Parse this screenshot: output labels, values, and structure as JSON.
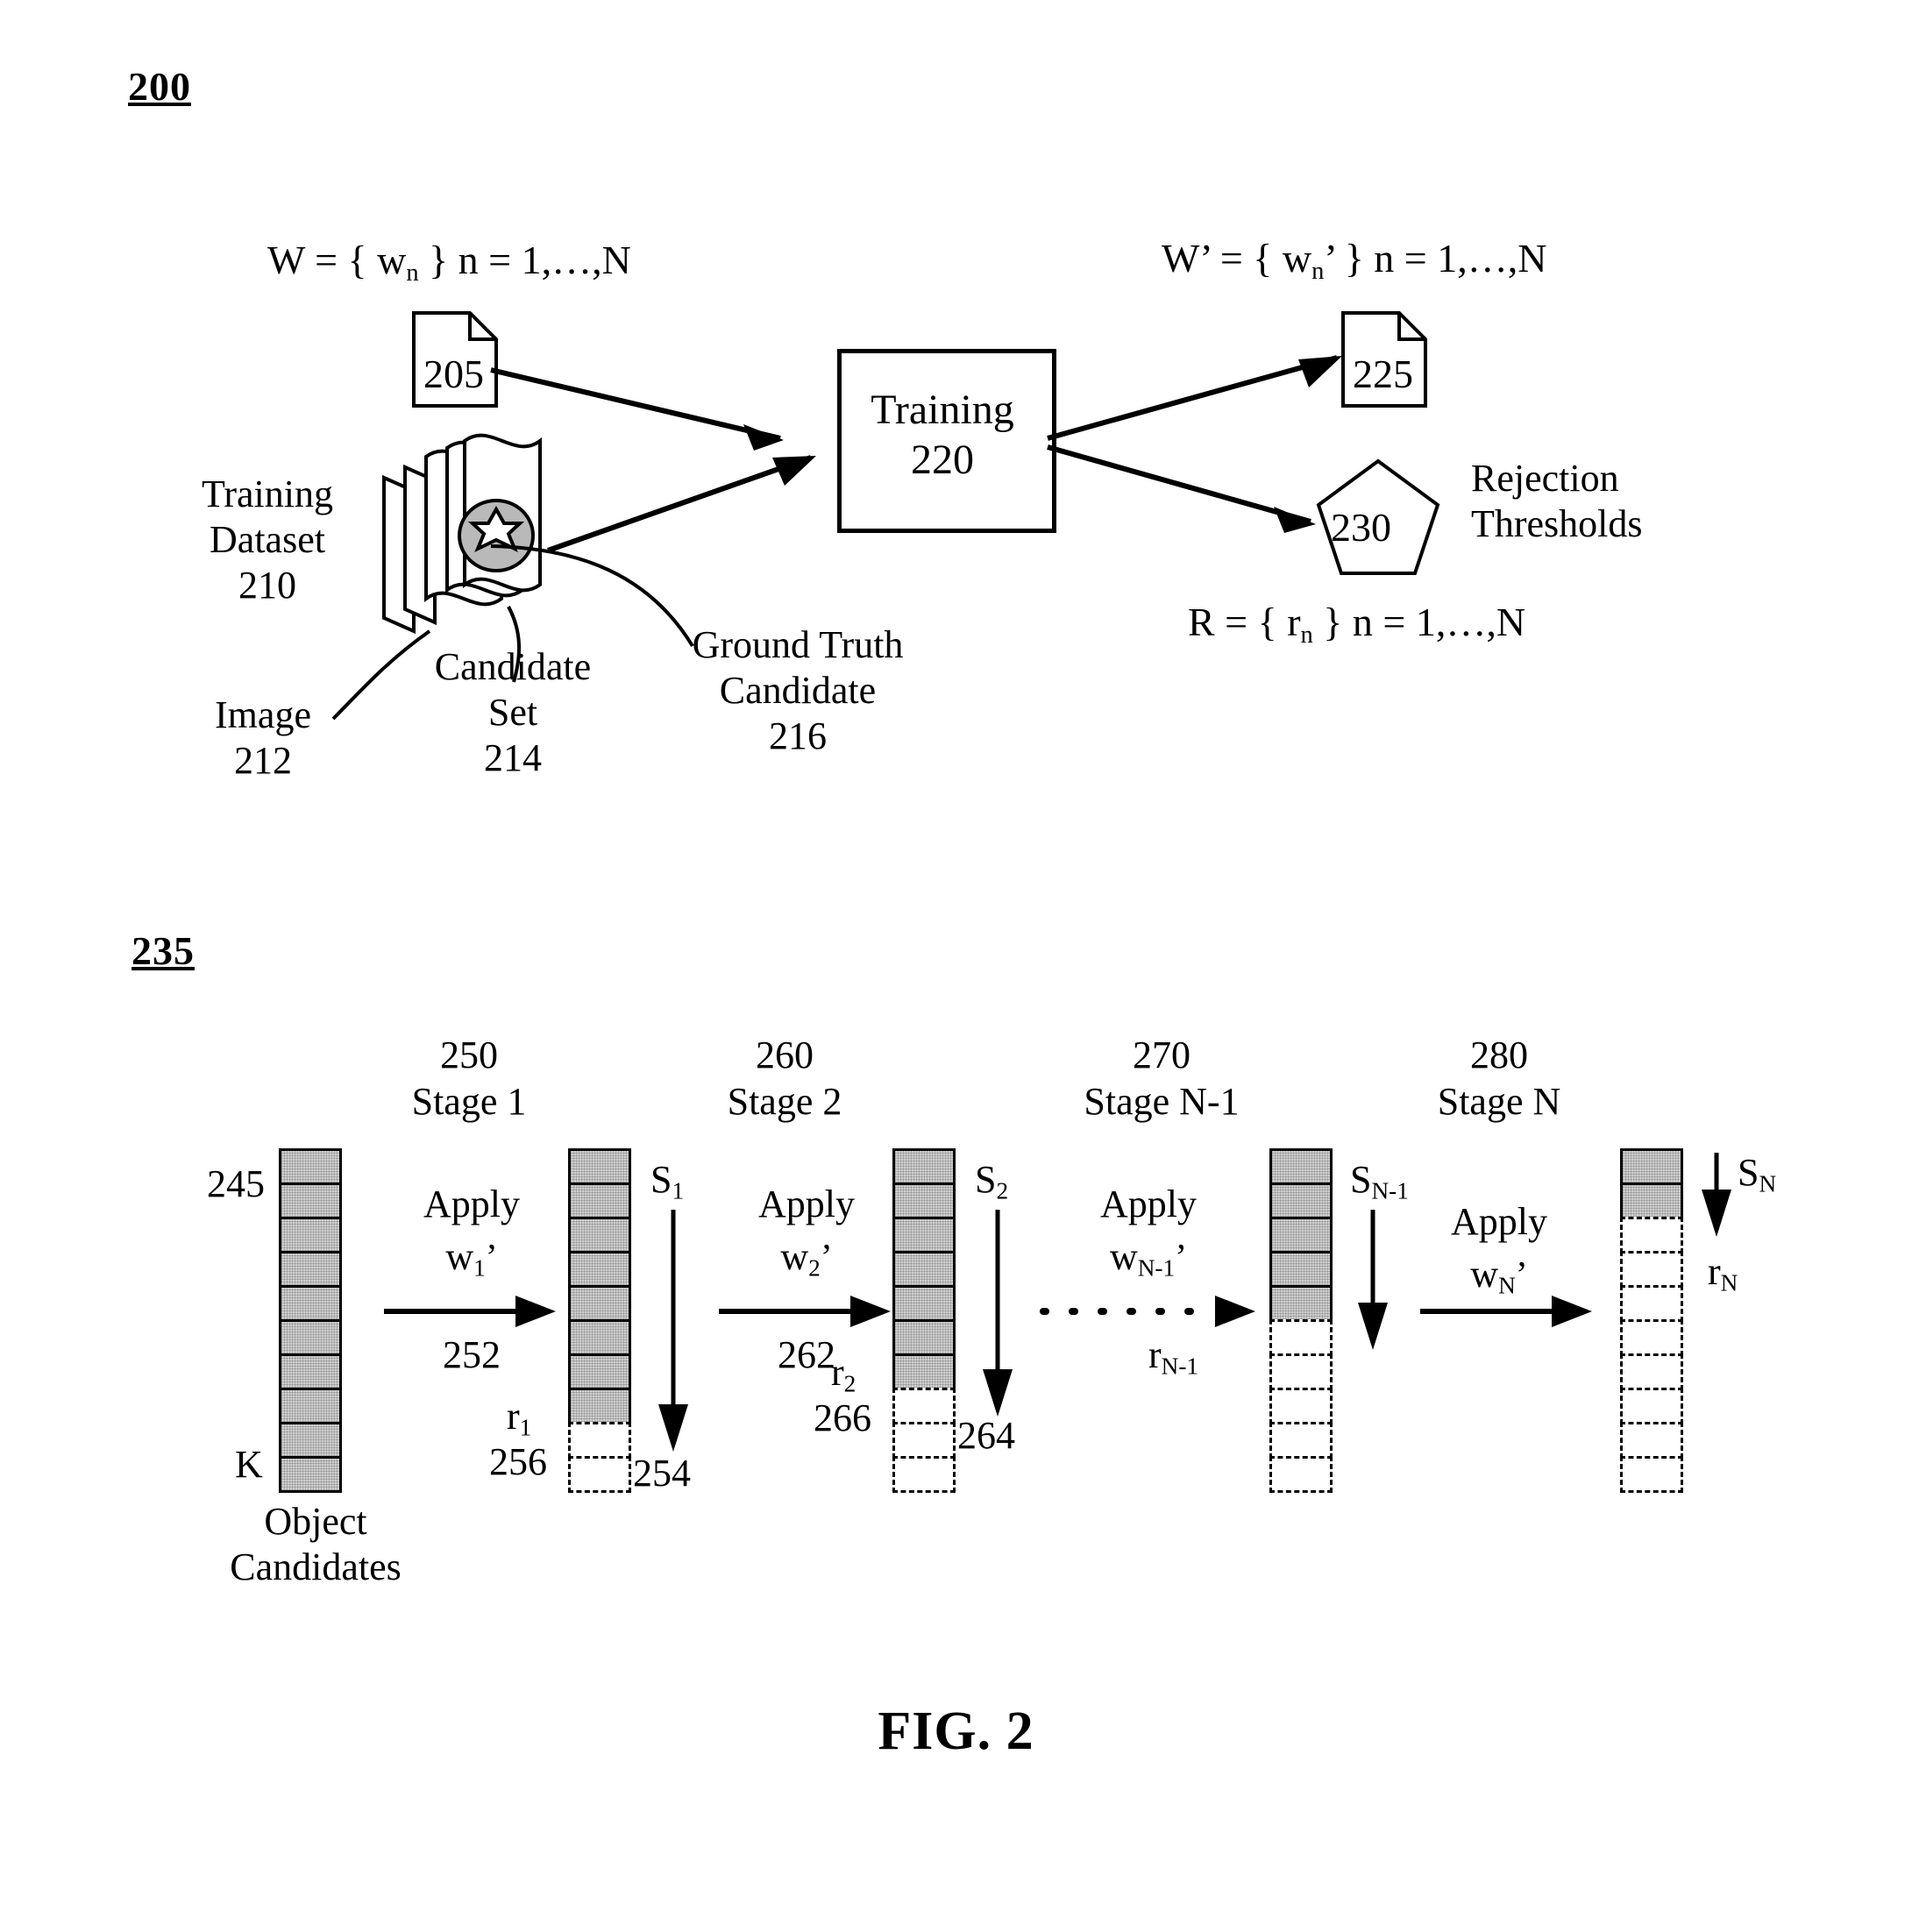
{
  "figure": {
    "caption": "FIG. 2",
    "top_diagram_id": "200",
    "bottom_diagram_id": "235"
  },
  "training_flow": {
    "weights_in_equation": "W = { w",
    "weights_in_equation_sub": "n",
    "weights_in_equation_tail": " } n = 1,…,N",
    "weights_in_doc_label": "205",
    "dataset_label_line1": "Training",
    "dataset_label_line2": "Dataset",
    "dataset_label_id": "210",
    "image_label": "Image",
    "image_label_id": "212",
    "candidate_set_label_line1": "Candidate",
    "candidate_set_label_line2": "Set",
    "candidate_set_label_id": "214",
    "ground_truth_label_line1": "Ground Truth",
    "ground_truth_label_line2": "Candidate",
    "ground_truth_label_id": "216",
    "training_box_label": "Training",
    "training_box_id": "220",
    "weights_out_equation": "W’ = { w",
    "weights_out_equation_sub": "n",
    "weights_out_equation_tail": "’ } n = 1,…,N",
    "weights_out_doc_label": "225",
    "thresholds_pentagon_label": "230",
    "thresholds_caption_line1": "Rejection",
    "thresholds_caption_line2": "Thresholds",
    "thresholds_equation": "R = { r",
    "thresholds_equation_sub": "n",
    "thresholds_equation_tail": " } n = 1,…,N"
  },
  "cascade": {
    "input_column": {
      "id_label": "245",
      "count_label": "K",
      "caption_line1": "Object",
      "caption_line2": "Candidates",
      "filled_cells": 10,
      "empty_cells": 0
    },
    "stages": [
      {
        "id": "250",
        "name": "Stage 1",
        "apply_label": "Apply",
        "apply_weight": "w",
        "apply_weight_sub": "1",
        "apply_weight_prime": "’",
        "arrow_id": "252",
        "score_label": "S",
        "score_sub": "1",
        "score_arrow_id": "254",
        "threshold_label": "r",
        "threshold_sub": "1",
        "threshold_id": "256",
        "filled_cells": 8,
        "empty_cells": 2
      },
      {
        "id": "260",
        "name": "Stage 2",
        "apply_label": "Apply",
        "apply_weight": "w",
        "apply_weight_sub": "2",
        "apply_weight_prime": "’",
        "arrow_id": "262",
        "score_label": "S",
        "score_sub": "2",
        "score_arrow_id": "264",
        "threshold_label": "r",
        "threshold_sub": "2",
        "threshold_id": "266",
        "filled_cells": 7,
        "empty_cells": 3
      },
      {
        "id": "270",
        "name": "Stage N-1",
        "apply_label": "Apply",
        "apply_weight": "w",
        "apply_weight_sub": "N-1",
        "apply_weight_prime": "’",
        "arrow_id": "",
        "score_label": "S",
        "score_sub": "N-1",
        "score_arrow_id": "",
        "threshold_label": "r",
        "threshold_sub": "N-1",
        "threshold_id": "",
        "filled_cells": 5,
        "empty_cells": 5
      },
      {
        "id": "280",
        "name": "Stage N",
        "apply_label": "Apply",
        "apply_weight": "w",
        "apply_weight_sub": "N",
        "apply_weight_prime": "’",
        "arrow_id": "",
        "score_label": "S",
        "score_sub": "N",
        "score_arrow_id": "",
        "threshold_label": "r",
        "threshold_sub": "N",
        "threshold_id": "",
        "filled_cells": 2,
        "empty_cells": 8
      }
    ]
  },
  "colors": {
    "ink": "#000000",
    "paper": "#ffffff",
    "cell_fill": "#cfcfcf"
  }
}
